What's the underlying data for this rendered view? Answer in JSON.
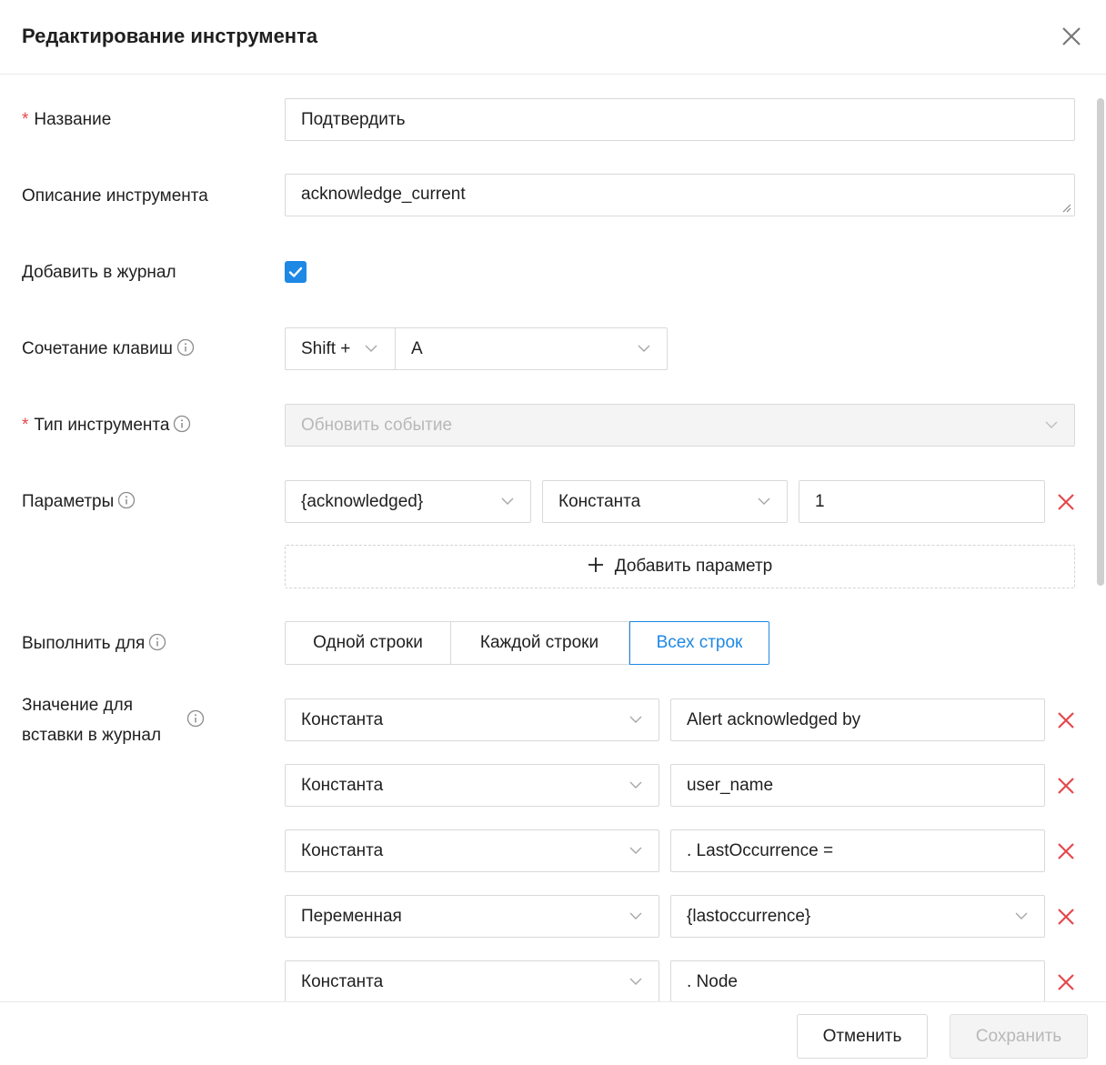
{
  "dialog": {
    "title": "Редактирование инструмента"
  },
  "form": {
    "name": {
      "label": "Название",
      "value": "Подтвердить"
    },
    "description": {
      "label": "Описание инструмента",
      "value": "acknowledge_current"
    },
    "journal": {
      "label": "Добавить в журнал",
      "checked": true
    },
    "hotkey": {
      "label": "Сочетание клавиш",
      "modifier": "Shift +",
      "key": "A"
    },
    "tool_type": {
      "label": "Тип инструмента",
      "value": "Обновить событие",
      "disabled": true
    },
    "params": {
      "label": "Параметры",
      "rows": [
        {
          "field": "{acknowledged}",
          "kind": "Константа",
          "value": "1"
        }
      ],
      "add_label": "Добавить параметр"
    },
    "execute_for": {
      "label": "Выполнить для",
      "options": [
        "Одной строки",
        "Каждой строки",
        "Всех строк"
      ],
      "selected": "Всех строк"
    },
    "journal_values": {
      "label_line1": "Значение для",
      "label_line2": "вставки в журнал",
      "rows": [
        {
          "kind": "Константа",
          "value": "Alert acknowledged by"
        },
        {
          "kind": "Константа",
          "value": "user_name"
        },
        {
          "kind": "Константа",
          "value": ". LastOccurrence ="
        },
        {
          "kind": "Переменная",
          "value": "{lastoccurrence}"
        },
        {
          "kind": "Константа",
          "value": ". Node"
        }
      ]
    }
  },
  "footer": {
    "cancel_label": "Отменить",
    "save_label": "Сохранить"
  },
  "colors": {
    "accent": "#1e88e5",
    "danger": "#e5484d",
    "border": "#d9d9d9",
    "disabled_text": "#b8b8b8"
  }
}
